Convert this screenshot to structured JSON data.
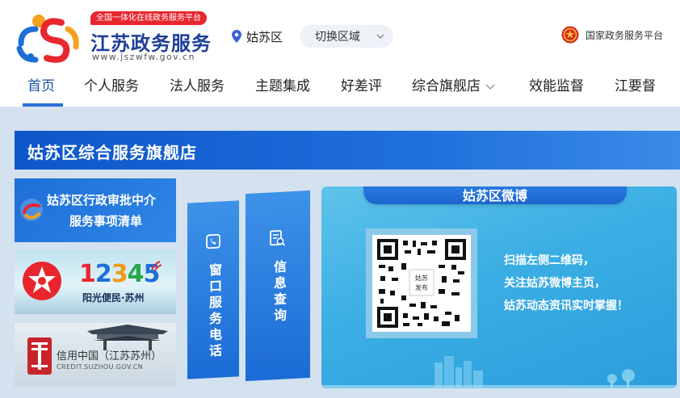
{
  "header": {
    "slogan": "全国一体化在线政务服务平台",
    "brand_name": "江苏政务服务",
    "brand_domain": "www.jszwfw.gov.cn",
    "location": "姑苏区",
    "switch_region_label": "切换区域",
    "national_link": "国家政务服务平台"
  },
  "nav": {
    "items": [
      {
        "label": "首页",
        "active": true
      },
      {
        "label": "个人服务"
      },
      {
        "label": "法人服务"
      },
      {
        "label": "主题集成"
      },
      {
        "label": "好差评"
      },
      {
        "label": "综合旗舰店"
      },
      {
        "label": "效能监督"
      },
      {
        "label": "江要督"
      }
    ]
  },
  "main": {
    "banner_title": "姑苏区综合服务旗舰店",
    "cards": [
      {
        "line1": "姑苏区行政审批中介",
        "line2": "服务事项清单"
      },
      {
        "number_parts": [
          "1",
          "2",
          "3",
          "4",
          "5"
        ],
        "sub": "阳光便民·苏州"
      },
      {
        "line1": "信用中国（江苏苏州）",
        "line2": "CREDIT.SUZHOU.GOV.CN"
      }
    ],
    "vertical_cards": [
      {
        "label": "窗口服务电话"
      },
      {
        "label": "信息查询"
      }
    ],
    "weibo": {
      "title": "姑苏区微博",
      "qr_center_text": "姑苏发布",
      "lines": [
        "扫描左侧二维码，",
        "关注姑苏微博主页，",
        "姑苏动态资讯实时掌握！"
      ]
    }
  },
  "colors": {
    "brand_blue": "#1d3f9a",
    "nav_active": "#2c6fd9",
    "banner_blue": "#0d56c9",
    "red": "#e8262e"
  }
}
